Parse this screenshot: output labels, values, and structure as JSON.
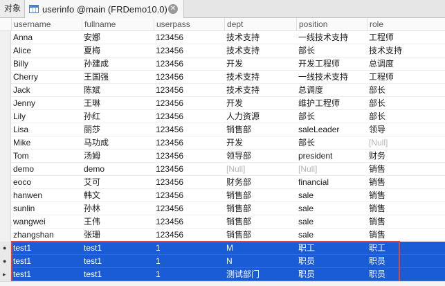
{
  "tabs": {
    "objects_label": "对象",
    "active_title": "userinfo @main (FRDemo10.0)"
  },
  "columns": [
    "username",
    "fullname",
    "userpass",
    "dept",
    "position",
    "role"
  ],
  "null_text": "[Null]",
  "rows": [
    {
      "username": "Anna",
      "fullname": "安娜",
      "userpass": "123456",
      "dept": "技术支持",
      "position": "一线技术支持",
      "role": "工程师"
    },
    {
      "username": "Alice",
      "fullname": "夏梅",
      "userpass": "123456",
      "dept": "技术支持",
      "position": "部长",
      "role": "技术支持"
    },
    {
      "username": "Billy",
      "fullname": "孙建成",
      "userpass": "123456",
      "dept": "开发",
      "position": "开发工程师",
      "role": "总调度"
    },
    {
      "username": "Cherry",
      "fullname": "王国强",
      "userpass": "123456",
      "dept": "技术支持",
      "position": "一线技术支持",
      "role": "工程师"
    },
    {
      "username": "Jack",
      "fullname": "陈斌",
      "userpass": "123456",
      "dept": "技术支持",
      "position": "总调度",
      "role": "部长"
    },
    {
      "username": "Jenny",
      "fullname": "王琳",
      "userpass": "123456",
      "dept": "开发",
      "position": "维护工程师",
      "role": "部长"
    },
    {
      "username": "Lily",
      "fullname": "孙红",
      "userpass": "123456",
      "dept": "人力资源",
      "position": "部长",
      "role": "部长"
    },
    {
      "username": "Lisa",
      "fullname": "丽莎",
      "userpass": "123456",
      "dept": "销售部",
      "position": "saleLeader",
      "role": "领导"
    },
    {
      "username": "Mike",
      "fullname": "马功成",
      "userpass": "123456",
      "dept": "开发",
      "position": "部长",
      "role": null
    },
    {
      "username": "Tom",
      "fullname": "汤姆",
      "userpass": "123456",
      "dept": "领导部",
      "position": "president",
      "role": "财务"
    },
    {
      "username": "demo",
      "fullname": "demo",
      "userpass": "123456",
      "dept": null,
      "position": null,
      "role": "销售"
    },
    {
      "username": "eoco",
      "fullname": "艾可",
      "userpass": "123456",
      "dept": "财务部",
      "position": "financial",
      "role": "销售"
    },
    {
      "username": "hanwen",
      "fullname": "韩文",
      "userpass": "123456",
      "dept": "销售部",
      "position": "sale",
      "role": "销售"
    },
    {
      "username": "sunlin",
      "fullname": "孙林",
      "userpass": "123456",
      "dept": "销售部",
      "position": "sale",
      "role": "销售"
    },
    {
      "username": "wangwei",
      "fullname": "王伟",
      "userpass": "123456",
      "dept": "销售部",
      "position": "sale",
      "role": "销售"
    },
    {
      "username": "zhangshan",
      "fullname": "张珊",
      "userpass": "123456",
      "dept": "销售部",
      "position": "sale",
      "role": "销售"
    },
    {
      "username": "test1",
      "fullname": "test1",
      "userpass": "1",
      "dept": "M",
      "position": "职工",
      "role": "职工",
      "selected": true,
      "marker": "●"
    },
    {
      "username": "test1",
      "fullname": "test1",
      "userpass": "1",
      "dept": "N",
      "position": "职员",
      "role": "职员",
      "selected": true,
      "marker": "●"
    },
    {
      "username": "test1",
      "fullname": "test1",
      "userpass": "1",
      "dept": "测试部门",
      "position": "职员",
      "role": "职员",
      "selected": true,
      "marker": "▸"
    }
  ],
  "colors": {
    "selection": "#1a5bd6",
    "highlight_border": "#e0453a",
    "null_text": "#b5b5b5"
  }
}
